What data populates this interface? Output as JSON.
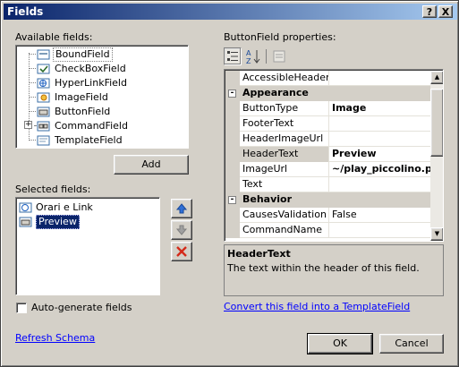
{
  "window": {
    "title": "Fields",
    "help_button": "?",
    "close_button": "X"
  },
  "available": {
    "label": "Available fields:",
    "items": [
      {
        "label": "BoundField"
      },
      {
        "label": "CheckBoxField"
      },
      {
        "label": "HyperLinkField"
      },
      {
        "label": "ImageField"
      },
      {
        "label": "ButtonField"
      },
      {
        "label": "CommandField"
      },
      {
        "label": "TemplateField"
      }
    ],
    "add_button": "Add"
  },
  "selected": {
    "label": "Selected fields:",
    "items": [
      {
        "label": "Orari e Link"
      },
      {
        "label": "Preview"
      }
    ]
  },
  "auto_generate": {
    "label": "Auto-generate fields",
    "checked": false
  },
  "refresh_link": "Refresh Schema",
  "properties": {
    "label": "ButtonField properties:",
    "top_row": {
      "name": "AccessibleHeaderTe",
      "value": ""
    },
    "categories": [
      {
        "name": "Appearance",
        "rows": [
          {
            "name": "ButtonType",
            "value": "Image",
            "bold": true
          },
          {
            "name": "FooterText",
            "value": ""
          },
          {
            "name": "HeaderImageUrl",
            "value": ""
          },
          {
            "name": "HeaderText",
            "value": "Preview",
            "bold": true
          },
          {
            "name": "ImageUrl",
            "value": "~/play_piccolino.pn",
            "bold": true
          },
          {
            "name": "Text",
            "value": ""
          }
        ]
      },
      {
        "name": "Behavior",
        "rows": [
          {
            "name": "CausesValidation",
            "value": "False"
          },
          {
            "name": "CommandName",
            "value": ""
          }
        ]
      }
    ],
    "description_title": "HeaderText",
    "description_text": "The text within the header of this field.",
    "convert_link": "Convert this field into a TemplateField"
  },
  "buttons": {
    "ok": "OK",
    "cancel": "Cancel"
  },
  "colors": {
    "selection": "#0a246a",
    "link": "#0000ff",
    "title_start": "#0a246a",
    "title_end": "#a6caf0"
  }
}
